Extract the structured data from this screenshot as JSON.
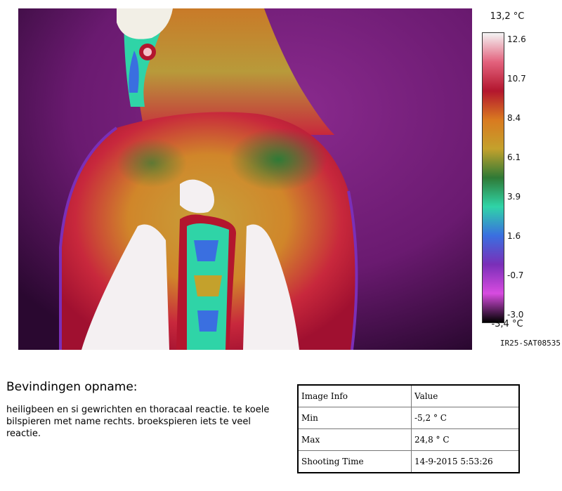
{
  "scale": {
    "max_label": "13,2 °C",
    "min_label": "-3,4 °C",
    "ticks": [
      "12.6",
      "10.7",
      "8.4",
      "6.1",
      "3.9",
      "1.6",
      "-0.7",
      "-3.0"
    ],
    "gradient_colors": [
      "#f4f4f4",
      "#e3627d",
      "#b3162e",
      "#d97a20",
      "#c4a12c",
      "#2f7a36",
      "#2fd4a7",
      "#3a6fe0",
      "#7a2fb8",
      "#d84be0",
      "#000000"
    ],
    "camera_id": "IR25-SAT08535"
  },
  "findings": {
    "title": "Bevindingen opname:",
    "text": "heiligbeen en si gewrichten en thoracaal reactie. te koele bilspieren met name rechts. broekspieren iets te veel reactie."
  },
  "info_table": {
    "header": [
      "Image Info",
      "Value"
    ],
    "rows": [
      {
        "label": "Min",
        "value": "-5,2 ° C"
      },
      {
        "label": "Max",
        "value": "24,8 ° C"
      },
      {
        "label": "Shooting Time",
        "value": "14-9-2015 5:53:26"
      }
    ]
  }
}
